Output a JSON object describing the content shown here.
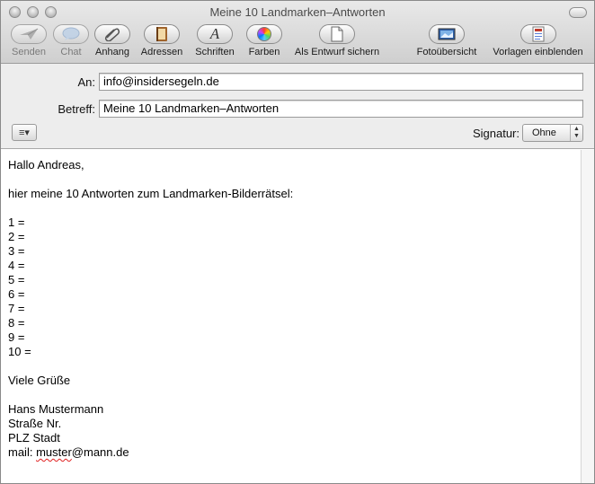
{
  "window": {
    "title": "Meine 10 Landmarken–Antworten"
  },
  "toolbar": [
    {
      "label": "Senden",
      "icon": "paper-plane-icon",
      "enabled": false
    },
    {
      "label": "Chat",
      "icon": "chat-bubble-icon",
      "enabled": false
    },
    {
      "label": "Anhang",
      "icon": "paperclip-icon",
      "enabled": true
    },
    {
      "label": "Adressen",
      "icon": "address-book-icon",
      "enabled": true
    },
    {
      "label": "Schriften",
      "icon": "font-icon",
      "enabled": true
    },
    {
      "label": "Farben",
      "icon": "color-wheel-icon",
      "enabled": true
    },
    {
      "label": "Als Entwurf sichern",
      "icon": "draft-icon",
      "enabled": true
    },
    {
      "label": "Fotoübersicht",
      "icon": "photo-browser-icon",
      "enabled": true
    },
    {
      "label": "Vorlagen einblenden",
      "icon": "stationery-icon",
      "enabled": true
    }
  ],
  "fields": {
    "to_label": "An:",
    "to_value": "info@insidersegeln.de",
    "subject_label": "Betreff:",
    "subject_value": "Meine 10 Landmarken–Antworten",
    "signature_label": "Signatur:",
    "signature_value": "Ohne"
  },
  "message": {
    "greeting": "Hallo Andreas,",
    "intro": "hier meine 10 Antworten zum Landmarken-Bilderrätsel:",
    "answers": [
      "1 =",
      "2 =",
      "3 =",
      "4 =",
      "5 =",
      "6 =",
      "7 =",
      "8 =",
      "9 =",
      "10 ="
    ],
    "closing": "Viele Grüße",
    "name": "Hans Mustermann",
    "street": "Straße Nr.",
    "city": "PLZ Stadt",
    "mail_prefix": "mail: ",
    "mail_misspelled": "muster",
    "mail_suffix": "@mann.de"
  }
}
